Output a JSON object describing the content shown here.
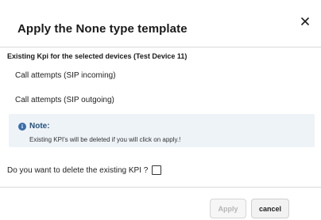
{
  "dialog": {
    "title": "Apply the None type template",
    "close_icon": "close-icon"
  },
  "body": {
    "section_heading": "Existing Kpi for the selected devices (Test Device 11)",
    "kpis": [
      "Call attempts (SIP incoming)",
      "Call attempts (SIP outgoing)"
    ],
    "note": {
      "icon": "info-icon",
      "icon_glyph": "i",
      "title": "Note:",
      "text": "Existing KPI's will be deleted if you will click on apply.!"
    },
    "confirm_label": "Do you want to delete the existing KPI ?",
    "confirm_checked": false
  },
  "footer": {
    "apply_label": "Apply",
    "apply_disabled": true,
    "cancel_label": "cancel"
  },
  "colors": {
    "note_background": "#eef3f8",
    "note_accent": "#3b6ea8",
    "disabled_text": "#b5b5b5"
  }
}
